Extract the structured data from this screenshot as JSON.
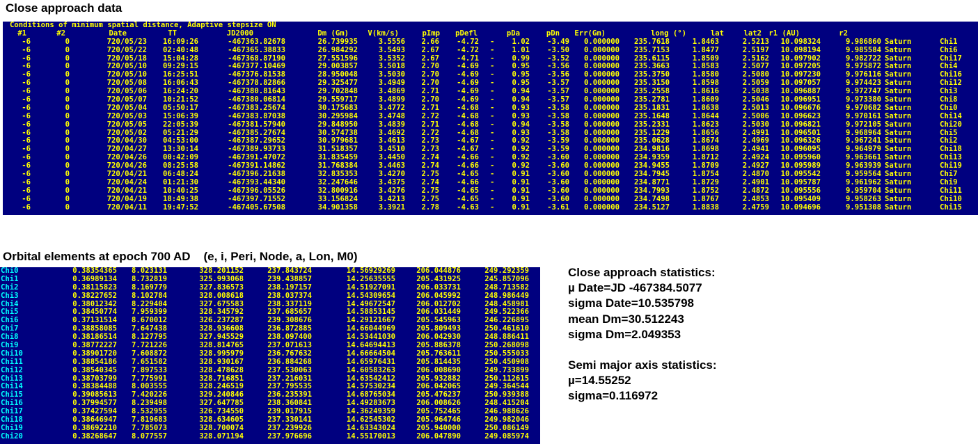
{
  "approach_title": "Close approach data",
  "approach_caption": "Conditions of minimum spatial distance, Adaptive stepsize ON",
  "approach_headers": [
    "#1",
    "#2",
    "Date",
    "TT",
    "JD2000",
    "Dm (Gm)",
    "V(km/s)",
    "pImp",
    "pDefl",
    "pDa",
    "pDn",
    "Err(Gm)",
    "long (°)",
    "lat",
    "lat2",
    "r1 (AU)",
    "r2",
    "",
    ""
  ],
  "approach_rows": [
    [
      "-6",
      "0",
      "720/05/23",
      "16:09:26",
      "-467363.82678",
      "26.739935",
      "3.5556",
      "2.66",
      "-4.72",
      "-",
      "1.02",
      "-3.49",
      "0.000000",
      "235.7618",
      "1.8463",
      "2.5213",
      "10.098324",
      "9.986860",
      "Saturn",
      "Chi1"
    ],
    [
      "-6",
      "0",
      "720/05/22",
      "02:40:48",
      "-467365.38833",
      "26.984292",
      "3.5493",
      "2.67",
      "-4.72",
      "-",
      "1.01",
      "-3.50",
      "0.000000",
      "235.7153",
      "1.8477",
      "2.5197",
      "10.098194",
      "9.985584",
      "Saturn",
      "Chi6"
    ],
    [
      "-6",
      "0",
      "720/05/18",
      "15:04:28",
      "-467368.87190",
      "27.551596",
      "3.5352",
      "2.67",
      "-4.71",
      "-",
      "0.99",
      "-3.52",
      "0.000000",
      "235.6115",
      "1.8509",
      "2.5162",
      "10.097902",
      "9.982722",
      "Saturn",
      "Chi17"
    ],
    [
      "-6",
      "0",
      "720/05/10",
      "09:29:15",
      "-467377.10469",
      "29.003857",
      "3.5018",
      "2.70",
      "-4.69",
      "-",
      "0.95",
      "-3.56",
      "0.000000",
      "235.3663",
      "1.8583",
      "2.5077",
      "10.097205",
      "9.975872",
      "Saturn",
      "Chi4"
    ],
    [
      "-6",
      "0",
      "720/05/10",
      "16:25:51",
      "-467376.81538",
      "28.950048",
      "3.5030",
      "2.70",
      "-4.69",
      "-",
      "0.95",
      "-3.56",
      "0.000000",
      "235.3750",
      "1.8580",
      "2.5080",
      "10.097230",
      "9.976116",
      "Saturn",
      "Chi16"
    ],
    [
      "-6",
      "0",
      "720/05/08",
      "16:06:43",
      "-467378.82866",
      "29.325477",
      "3.4949",
      "2.70",
      "-4.69",
      "-",
      "0.95",
      "-3.57",
      "0.000000",
      "235.3150",
      "1.8598",
      "2.5059",
      "10.097057",
      "9.974423",
      "Saturn",
      "Chi12"
    ],
    [
      "-6",
      "0",
      "720/05/06",
      "16:24:20",
      "-467380.81643",
      "29.702848",
      "3.4869",
      "2.71",
      "-4.69",
      "-",
      "0.94",
      "-3.57",
      "0.000000",
      "235.2558",
      "1.8616",
      "2.5038",
      "10.096887",
      "9.972747",
      "Saturn",
      "Chi3"
    ],
    [
      "-6",
      "0",
      "720/05/07",
      "10:21:52",
      "-467380.06814",
      "29.559717",
      "3.4899",
      "2.70",
      "-4.69",
      "-",
      "0.94",
      "-3.57",
      "0.000000",
      "235.2781",
      "1.8609",
      "2.5046",
      "10.096951",
      "9.973380",
      "Saturn",
      "Chi8"
    ],
    [
      "-6",
      "0",
      "720/05/04",
      "05:50:17",
      "-467383.25674",
      "30.175683",
      "3.4772",
      "2.71",
      "-4.68",
      "-",
      "0.93",
      "-3.58",
      "0.000000",
      "235.1831",
      "1.8638",
      "2.5013",
      "10.096676",
      "9.970682",
      "Saturn",
      "Chi0"
    ],
    [
      "-6",
      "0",
      "720/05/03",
      "15:06:39",
      "-467383.87038",
      "30.295984",
      "3.4748",
      "2.72",
      "-4.68",
      "-",
      "0.93",
      "-3.58",
      "0.000000",
      "235.1648",
      "1.8644",
      "2.5006",
      "10.096623",
      "9.970161",
      "Saturn",
      "Chi14"
    ],
    [
      "-6",
      "0",
      "720/05/05",
      "22:05:39",
      "-467381.57940",
      "29.848950",
      "3.4839",
      "2.71",
      "-4.68",
      "-",
      "0.94",
      "-3.58",
      "0.000000",
      "235.2331",
      "1.8623",
      "2.5030",
      "10.096821",
      "9.972105",
      "Saturn",
      "Chi20"
    ],
    [
      "-6",
      "0",
      "720/05/02",
      "05:21:29",
      "-467385.27674",
      "30.574738",
      "3.4692",
      "2.72",
      "-4.68",
      "-",
      "0.93",
      "-3.58",
      "0.000000",
      "235.1229",
      "1.8656",
      "2.4991",
      "10.096501",
      "9.968964",
      "Saturn",
      "Chi5"
    ],
    [
      "-6",
      "0",
      "720/04/30",
      "04:53:00",
      "-467387.29652",
      "30.979681",
      "3.4613",
      "2.73",
      "-4.67",
      "-",
      "0.92",
      "-3.59",
      "0.000000",
      "235.0628",
      "1.8674",
      "2.4969",
      "10.096326",
      "9.967241",
      "Saturn",
      "Chi2"
    ],
    [
      "-6",
      "0",
      "720/04/27",
      "13:30:14",
      "-467389.93733",
      "31.518357",
      "3.4510",
      "2.73",
      "-4.67",
      "-",
      "0.92",
      "-3.59",
      "0.000000",
      "234.9816",
      "1.8698",
      "2.4941",
      "10.096095",
      "9.964979",
      "Saturn",
      "Chi18"
    ],
    [
      "-6",
      "0",
      "720/04/26",
      "00:42:09",
      "-467391.47072",
      "31.835459",
      "3.4450",
      "2.74",
      "-4.66",
      "-",
      "0.92",
      "-3.60",
      "0.000000",
      "234.9359",
      "1.8712",
      "2.4924",
      "10.095960",
      "9.963661",
      "Saturn",
      "Chi13"
    ],
    [
      "-6",
      "0",
      "720/04/26",
      "08:25:58",
      "-467391.14862",
      "31.768384",
      "3.4463",
      "2.74",
      "-4.66",
      "-",
      "0.92",
      "-3.60",
      "0.000000",
      "234.9455",
      "1.8709",
      "2.4927",
      "10.095989",
      "9.963939",
      "Saturn",
      "Chi19"
    ],
    [
      "-6",
      "0",
      "720/04/21",
      "06:48:24",
      "-467396.21638",
      "32.835353",
      "3.4270",
      "2.75",
      "-4.65",
      "-",
      "0.91",
      "-3.60",
      "0.000000",
      "234.7945",
      "1.8754",
      "2.4870",
      "10.095542",
      "9.959564",
      "Saturn",
      "Chi7"
    ],
    [
      "-6",
      "0",
      "720/04/24",
      "01:21:30",
      "-467393.44340",
      "32.247646",
      "3.4375",
      "2.74",
      "-4.66",
      "-",
      "0.91",
      "-3.60",
      "0.000000",
      "234.8771",
      "1.8729",
      "2.4901",
      "10.095787",
      "9.961962",
      "Saturn",
      "Chi9"
    ],
    [
      "-6",
      "0",
      "720/04/21",
      "10:40:25",
      "-467396.05526",
      "32.800916",
      "3.4276",
      "2.75",
      "-4.65",
      "-",
      "0.91",
      "-3.60",
      "0.000000",
      "234.7993",
      "1.8752",
      "2.4872",
      "10.095556",
      "9.959704",
      "Saturn",
      "Chi11"
    ],
    [
      "-6",
      "0",
      "720/04/19",
      "18:49:38",
      "-467397.71552",
      "33.156824",
      "3.4213",
      "2.75",
      "-4.65",
      "-",
      "0.91",
      "-3.60",
      "0.000000",
      "234.7498",
      "1.8767",
      "2.4853",
      "10.095409",
      "9.958263",
      "Saturn",
      "Chi10"
    ],
    [
      "-6",
      "0",
      "720/04/11",
      "19:47:52",
      "-467405.67508",
      "34.901358",
      "3.3921",
      "2.78",
      "-4.63",
      "-",
      "0.91",
      "-3.61",
      "0.000000",
      "234.5127",
      "1.8838",
      "2.4759",
      "10.094696",
      "9.951308",
      "Saturn",
      "Chi15"
    ]
  ],
  "elements_title": "Orbital elements at epoch 700 AD    (e, i, Peri, Node, a, Lon, M0)",
  "elements_rows": [
    [
      "Chi0",
      "0.38354365",
      "8.023131",
      "328.201152",
      "237.843724",
      "14.56929269",
      "206.044876",
      "249.292359"
    ],
    [
      "Chi1",
      "0.36989134",
      "8.732819",
      "325.993068",
      "239.438857",
      "14.25635555",
      "205.431925",
      "245.857096"
    ],
    [
      "Chi2",
      "0.38115823",
      "8.169779",
      "327.836573",
      "238.197157",
      "14.51927091",
      "206.033731",
      "248.713582"
    ],
    [
      "Chi3",
      "0.38227652",
      "8.102784",
      "328.008618",
      "238.037374",
      "14.54309654",
      "206.045992",
      "248.986449"
    ],
    [
      "Chi4",
      "0.38012342",
      "8.229404",
      "327.675583",
      "238.337119",
      "14.49672547",
      "206.012702",
      "248.458981"
    ],
    [
      "Chi5",
      "0.38450774",
      "7.959399",
      "328.345792",
      "237.685657",
      "14.58853145",
      "206.031449",
      "249.522366"
    ],
    [
      "Chi6",
      "0.37131514",
      "8.670012",
      "326.237287",
      "239.308676",
      "14.29121667",
      "205.545963",
      "246.226895"
    ],
    [
      "Chi7",
      "0.38858085",
      "7.647438",
      "328.936608",
      "236.872885",
      "14.66044969",
      "205.809493",
      "250.461610"
    ],
    [
      "Chi8",
      "0.38186514",
      "8.127795",
      "327.945529",
      "238.097400",
      "14.53441030",
      "206.042930",
      "248.886411"
    ],
    [
      "Chi9",
      "0.38772227",
      "7.721226",
      "328.814765",
      "237.071613",
      "14.64694413",
      "205.886378",
      "250.268098"
    ],
    [
      "Chi10",
      "0.38901720",
      "7.608872",
      "328.995979",
      "236.767632",
      "14.66664504",
      "205.763611",
      "250.555033"
    ],
    [
      "Chi11",
      "0.38854186",
      "7.651582",
      "328.930167",
      "236.884268",
      "14.65976431",
      "205.814435",
      "250.450908"
    ],
    [
      "Chi12",
      "0.38540345",
      "7.897533",
      "328.478628",
      "237.530063",
      "14.60583263",
      "206.008690",
      "249.733899"
    ],
    [
      "Chi13",
      "0.38703799",
      "7.775991",
      "328.716851",
      "237.216031",
      "14.63542412",
      "205.932882",
      "250.112615"
    ],
    [
      "Chi14",
      "0.38384488",
      "8.003555",
      "328.246519",
      "237.795535",
      "14.57530234",
      "206.042065",
      "249.364544"
    ],
    [
      "Chi15",
      "0.39085613",
      "7.420226",
      "329.240846",
      "236.235391",
      "14.68765034",
      "205.476237",
      "250.939388"
    ],
    [
      "Chi16",
      "0.37994577",
      "8.239498",
      "327.647785",
      "238.360841",
      "14.49283673",
      "206.008626",
      "248.415204"
    ],
    [
      "Chi17",
      "0.37427594",
      "8.532955",
      "326.734550",
      "239.017915",
      "14.36249359",
      "205.752465",
      "246.988626"
    ],
    [
      "Chi18",
      "0.38646947",
      "7.819683",
      "328.634605",
      "237.330141",
      "14.62545302",
      "205.964746",
      "249.982046"
    ],
    [
      "Chi19",
      "0.38692210",
      "7.785073",
      "328.700074",
      "237.239926",
      "14.63343024",
      "205.940000",
      "250.086149"
    ],
    [
      "Chi20",
      "0.38268647",
      "8.077557",
      "328.071194",
      "237.976696",
      "14.55170013",
      "206.047890",
      "249.085974"
    ]
  ],
  "stats": {
    "ca_title": "Close approach statistics:",
    "mu_date": "µ Date=JD -467384.5077",
    "sigma_date": "sigma Date=10.535798",
    "mean_dm": "mean Dm=30.512243",
    "sigma_dm": "sigma Dm=2.049353",
    "sma_title": "Semi major axis statistics:",
    "mu_a": "µ=14.55252",
    "sigma_a": "sigma=0.116972"
  },
  "colors": {
    "panel_bg": "#00007f",
    "text_yellow": "#ffff00",
    "text_cyan": "#00ffff"
  }
}
